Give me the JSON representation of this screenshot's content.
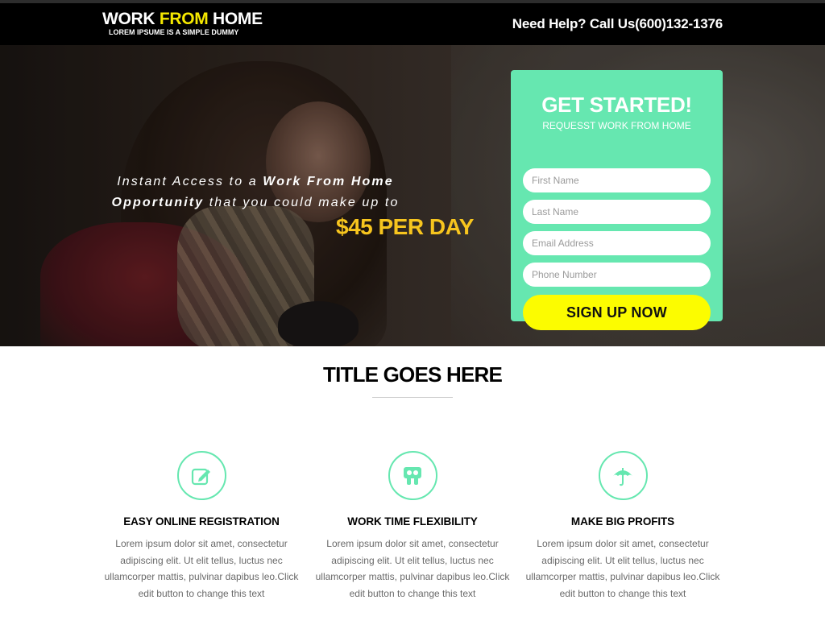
{
  "header": {
    "logo_part1": "WORK ",
    "logo_highlight": "FROM",
    "logo_part2": " HOME",
    "logo_sub": "LOREM IPSUME IS A SIMPLE DUMMY",
    "help_text": "Need Help? Call Us(600)132-1376"
  },
  "hero": {
    "tag_1": "Instant Access to a ",
    "tag_bold_1": "Work From Home Opportunity",
    "tag_2": " that you could make up to",
    "price": "$45 PER DAY"
  },
  "form": {
    "title": "GET STARTED!",
    "subtitle": "REQUESST WORK FROM HOME",
    "first_name_placeholder": "First Name",
    "last_name_placeholder": "Last Name",
    "email_placeholder": "Email Address",
    "phone_placeholder": "Phone Number",
    "submit_label": "SIGN UP NOW"
  },
  "section": {
    "title": "TITLE GOES HERE"
  },
  "features": [
    {
      "icon": "pencil-square-icon",
      "title": "EASY ONLINE REGISTRATION",
      "text": "Lorem ipsum dolor sit amet, consectetur adipiscing elit. Ut elit tellus, luctus nec ullamcorper mattis, pulvinar dapibus leo.Click edit button to change this text"
    },
    {
      "icon": "slideshare-icon",
      "title": "WORK TIME FLEXIBILITY",
      "text": "Lorem ipsum dolor sit amet, consectetur adipiscing elit. Ut elit tellus, luctus nec ullamcorper mattis, pulvinar dapibus leo.Click edit button to change this text"
    },
    {
      "icon": "umbrella-icon",
      "title": "MAKE BIG PROFITS",
      "text": "Lorem ipsum dolor sit amet, consectetur adipiscing elit. Ut elit tellus, luctus nec ullamcorper mattis, pulvinar dapibus leo.Click edit button to change this text"
    }
  ],
  "colors": {
    "accent": "#66e7b0",
    "cta": "#fcfc00",
    "price": "#f7c51e",
    "logo_highlight": "#f5e800"
  }
}
